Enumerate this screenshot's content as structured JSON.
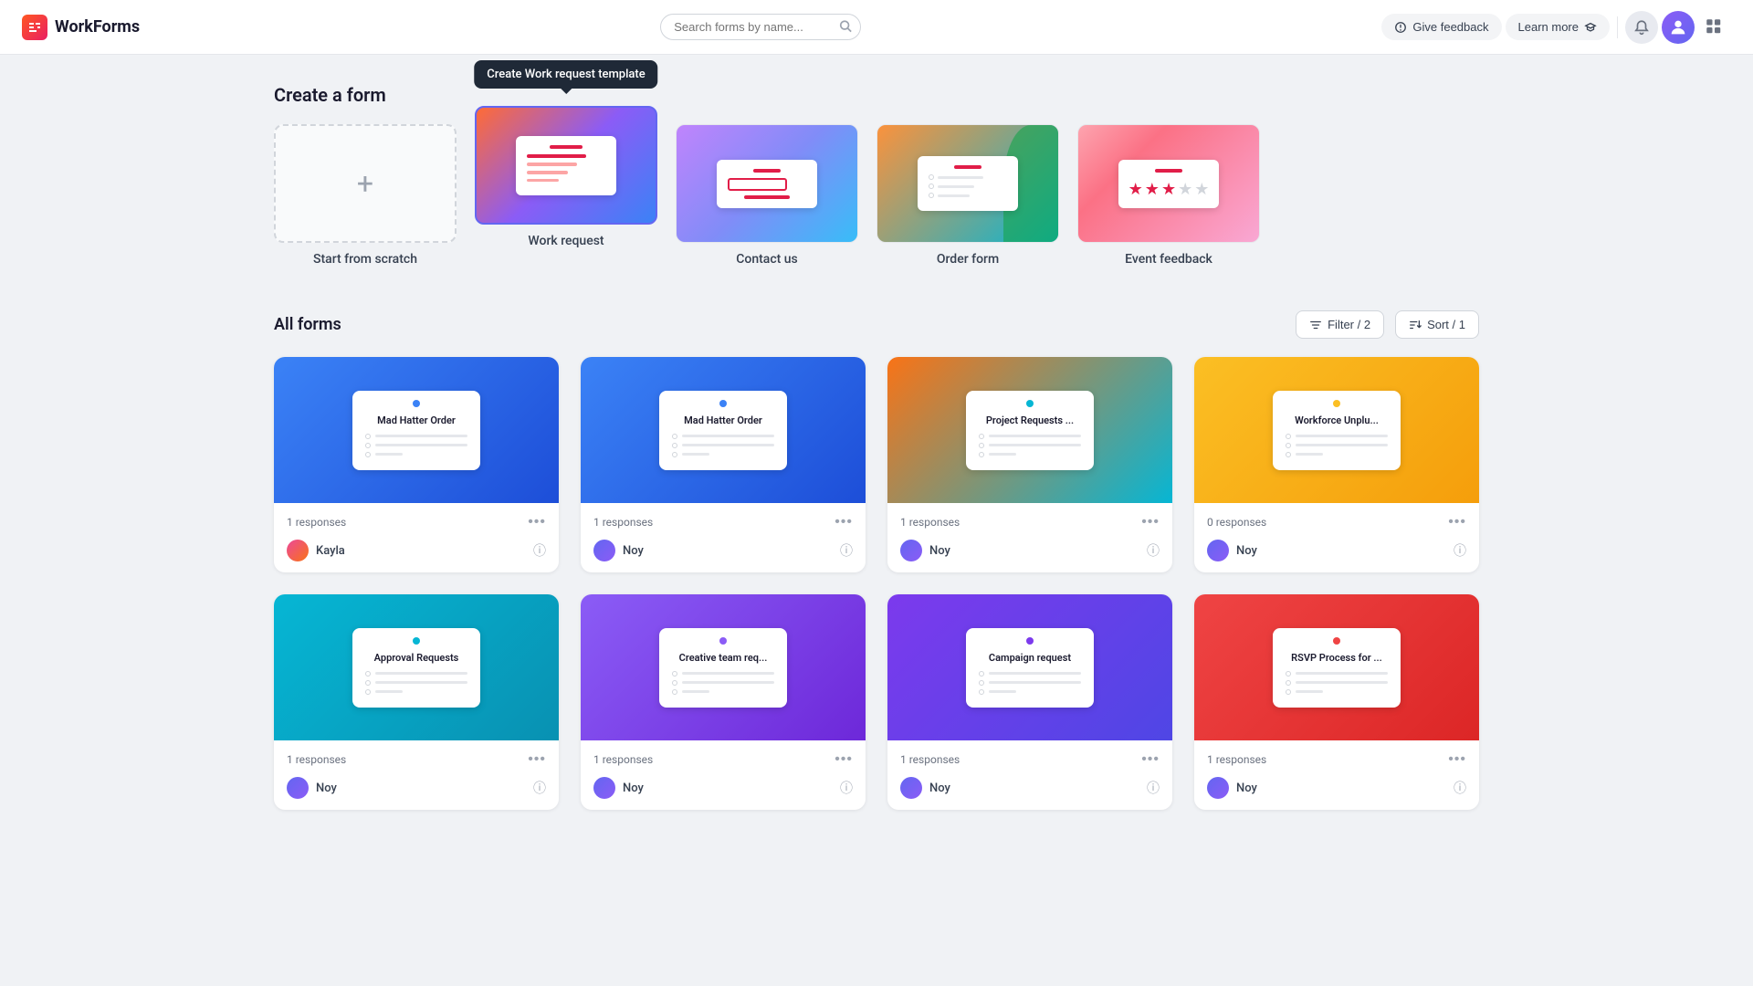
{
  "header": {
    "logo_text": "WorkForms",
    "search_placeholder": "Search forms by name...",
    "give_feedback_label": "Give feedback",
    "learn_more_label": "Learn more"
  },
  "create_section": {
    "title": "Create a form",
    "templates": [
      {
        "id": "scratch",
        "label": "Start from scratch",
        "type": "scratch"
      },
      {
        "id": "work-request",
        "label": "Work request",
        "type": "work-request",
        "active": true,
        "tooltip": "Create Work request template"
      },
      {
        "id": "contact-us",
        "label": "Contact us",
        "type": "contact-us"
      },
      {
        "id": "order-form",
        "label": "Order form",
        "type": "order-form"
      },
      {
        "id": "event-feedback",
        "label": "Event feedback",
        "type": "event-feedback"
      }
    ]
  },
  "all_forms": {
    "title": "All forms",
    "filter_label": "Filter / 2",
    "sort_label": "Sort / 1",
    "cards": [
      {
        "id": "card1",
        "title": "Mad Hatter Order",
        "color_class": "card-thumb-blue",
        "dot_class": "dot-blue",
        "responses": "1 responses",
        "author": "Kayla",
        "author_class": "author-avatar-kayla"
      },
      {
        "id": "card2",
        "title": "Mad Hatter Order",
        "color_class": "card-thumb-blue",
        "dot_class": "dot-blue",
        "responses": "1 responses",
        "author": "Noy",
        "author_class": "author-avatar-noy"
      },
      {
        "id": "card3",
        "title": "Project Requests ...",
        "color_class": "card-thumb-orange",
        "dot_class": "dot-teal",
        "responses": "1 responses",
        "author": "Noy",
        "author_class": "author-avatar-noy"
      },
      {
        "id": "card4",
        "title": "Workforce Unplu...",
        "color_class": "card-thumb-yellow",
        "dot_class": "dot-yellow",
        "responses": "0 responses",
        "author": "Noy",
        "author_class": "author-avatar-noy"
      },
      {
        "id": "card5",
        "title": "Approval Requests",
        "color_class": "card-thumb-teal",
        "dot_class": "dot-teal",
        "responses": "1 responses",
        "author": "Noy",
        "author_class": "author-avatar-noy"
      },
      {
        "id": "card6",
        "title": "Creative team req...",
        "color_class": "card-thumb-purple",
        "dot_class": "dot-purple",
        "responses": "1 responses",
        "author": "Noy",
        "author_class": "author-avatar-noy"
      },
      {
        "id": "card7",
        "title": "Campaign request",
        "color_class": "card-thumb-violet",
        "dot_class": "dot-violet",
        "responses": "1 responses",
        "author": "Noy",
        "author_class": "author-avatar-noy"
      },
      {
        "id": "card8",
        "title": "RSVP Process for ...",
        "color_class": "card-thumb-red",
        "dot_class": "dot-red",
        "responses": "1 responses",
        "author": "Noy",
        "author_class": "author-avatar-noy"
      }
    ]
  }
}
